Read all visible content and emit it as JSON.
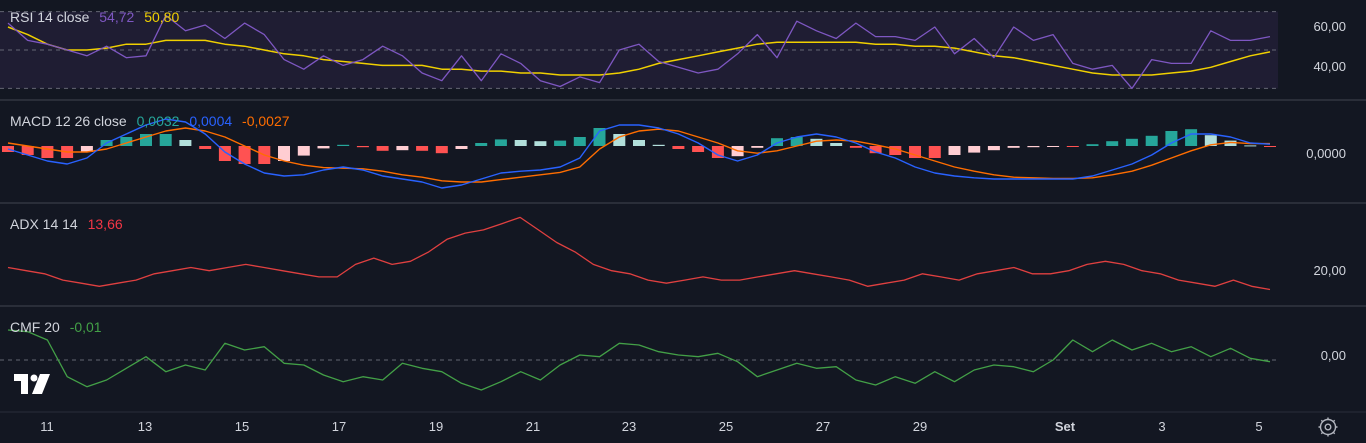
{
  "colors": {
    "background": "#131722",
    "rsi_band": "#1f1d33",
    "rsi": "#7e57c2",
    "rsi_ma": "#f0d000",
    "macd": "#2962ff",
    "signal": "#ff6d00",
    "hist_up_strong": "#26a69a",
    "hist_up_weak": "#b2dfdb",
    "hist_down_strong": "#ff5252",
    "hist_down_weak": "#ffcdd2",
    "adx": "#e04040",
    "cmf": "#43a047",
    "macd_value": "#26a69a",
    "macd_signal_value": "#2962ff",
    "macd_hist_value": "#ff6d00",
    "cmf_value": "#43a047"
  },
  "legends": {
    "rsi": {
      "label": "RSI 14 close",
      "value": "54,72",
      "ma": "50,80"
    },
    "macd": {
      "label": "MACD 12 26 close",
      "macd": "0,0032",
      "signal": "0,0004",
      "hist": "-0,0027"
    },
    "adx": {
      "label": "ADX 14 14",
      "value": "13,66"
    },
    "cmf": {
      "label": "CMF 20",
      "value": "-0,01"
    }
  },
  "axis_labels": {
    "rsi_upper": "60,00",
    "rsi_lower": "40,00",
    "macd_zero": "0,0000",
    "adx": "20,00",
    "cmf_zero": "0,00"
  },
  "x_ticks": [
    "11",
    "13",
    "15",
    "17",
    "19",
    "21",
    "23",
    "25",
    "27",
    "29",
    "Set",
    "3",
    "5"
  ],
  "chart_data": [
    {
      "type": "line",
      "name": "RSI",
      "ylim": [
        25,
        75
      ],
      "bands": [
        30,
        50,
        70
      ],
      "x": [
        0,
        1,
        2,
        3,
        4,
        5,
        6,
        7,
        8,
        9,
        10,
        11,
        12,
        13,
        14,
        15,
        16,
        17,
        18,
        19,
        20,
        21,
        22,
        23,
        24,
        25,
        26,
        27,
        28,
        29,
        30,
        31,
        32,
        33,
        34,
        35,
        36,
        37,
        38,
        39,
        40,
        41,
        42,
        43,
        44,
        45,
        46,
        47,
        48,
        49,
        50,
        51,
        52,
        53,
        54,
        55,
        56,
        57,
        58,
        59,
        60,
        61,
        62,
        63,
        64
      ],
      "rsi": [
        64,
        55,
        53,
        50,
        47,
        52,
        46,
        47,
        68,
        60,
        63,
        56,
        64,
        58,
        45,
        40,
        47,
        42,
        45,
        52,
        47,
        38,
        34,
        47,
        34,
        48,
        43,
        34,
        31,
        36,
        33,
        50,
        53,
        44,
        41,
        38,
        40,
        48,
        58,
        46,
        65,
        60,
        56,
        64,
        57,
        57,
        55,
        62,
        48,
        56,
        46,
        62,
        55,
        58,
        43,
        40,
        42,
        30,
        45,
        43,
        43,
        60,
        55,
        55,
        57
      ],
      "rsi_ma": [
        62,
        58,
        53,
        50,
        50,
        51,
        53,
        53,
        55,
        55,
        55,
        53,
        52,
        50,
        48,
        47,
        45,
        44,
        43,
        42,
        42,
        42,
        40,
        40,
        39,
        39,
        38,
        38,
        37,
        37,
        37,
        38,
        40,
        43,
        45,
        47,
        49,
        51,
        53,
        54,
        54,
        54,
        54,
        54,
        53,
        53,
        52,
        52,
        51,
        49,
        47,
        46,
        44,
        42,
        40,
        38,
        37,
        37,
        37,
        38,
        39,
        41,
        44,
        47,
        49
      ]
    },
    {
      "type": "line",
      "name": "MACD",
      "ylim": [
        -0.009,
        0.007
      ],
      "x": [
        0,
        1,
        2,
        3,
        4,
        5,
        6,
        7,
        8,
        9,
        10,
        11,
        12,
        13,
        14,
        15,
        16,
        17,
        18,
        19,
        20,
        21,
        22,
        23,
        24,
        25,
        26,
        27,
        28,
        29,
        30,
        31,
        32,
        33,
        34,
        35,
        36,
        37,
        38,
        39,
        40,
        41,
        42,
        43,
        44,
        45,
        46,
        47,
        48,
        49,
        50,
        51,
        52,
        53,
        54,
        55,
        56,
        57,
        58,
        59,
        60,
        61,
        62,
        63,
        64
      ],
      "macd": [
        -0.0005,
        -0.0015,
        -0.0025,
        -0.003,
        -0.002,
        0.0005,
        0.002,
        0.0035,
        0.0045,
        0.004,
        0.002,
        -0.001,
        -0.003,
        -0.0045,
        -0.005,
        -0.0048,
        -0.004,
        -0.0035,
        -0.004,
        -0.005,
        -0.0055,
        -0.006,
        -0.007,
        -0.0065,
        -0.0055,
        -0.0045,
        -0.0042,
        -0.004,
        -0.0035,
        -0.002,
        0.0025,
        0.0035,
        0.0035,
        0.003,
        0.002,
        0.0005,
        -0.0015,
        -0.0025,
        -0.0015,
        0.0005,
        0.0015,
        0.002,
        0.0015,
        0.0005,
        -0.001,
        -0.002,
        -0.0035,
        -0.0045,
        -0.005,
        -0.0053,
        -0.0055,
        -0.0055,
        -0.0055,
        -0.0055,
        -0.0055,
        -0.005,
        -0.004,
        -0.003,
        -0.0015,
        0.0005,
        0.002,
        0.002,
        0.0015,
        0.0005,
        0.0003
      ],
      "signal": [
        0.0005,
        0,
        -0.0005,
        -0.001,
        -0.001,
        -0.0005,
        0.0005,
        0.0015,
        0.0025,
        0.003,
        0.0025,
        0.0015,
        0,
        -0.0015,
        -0.0025,
        -0.0032,
        -0.0036,
        -0.0037,
        -0.0038,
        -0.0042,
        -0.0048,
        -0.0052,
        -0.0058,
        -0.006,
        -0.006,
        -0.0056,
        -0.0052,
        -0.0048,
        -0.0044,
        -0.0035,
        -0.0005,
        0.0015,
        0.0025,
        0.0028,
        0.0025,
        0.0015,
        0.0005,
        -0.0008,
        -0.0012,
        -0.0008,
        0,
        0.0008,
        0.001,
        0.0008,
        0.0002,
        -0.0005,
        -0.0015,
        -0.0025,
        -0.0035,
        -0.0042,
        -0.0048,
        -0.0052,
        -0.0053,
        -0.0054,
        -0.0054,
        -0.0053,
        -0.0048,
        -0.0042,
        -0.0032,
        -0.002,
        -0.0008,
        0.0002,
        0.0006,
        0.0004,
        0.0004
      ],
      "histogram": [
        -0.001,
        -0.0015,
        -0.002,
        -0.002,
        -0.001,
        0.001,
        0.0015,
        0.002,
        0.002,
        0.001,
        -0.0005,
        -0.0025,
        -0.003,
        -0.003,
        -0.0025,
        -0.0016,
        -0.0004,
        0.0002,
        -0.0002,
        -0.0008,
        -0.0007,
        -0.0008,
        -0.0012,
        -0.0005,
        0.0005,
        0.0011,
        0.001,
        0.0008,
        0.0009,
        0.0015,
        0.003,
        0.002,
        0.001,
        0.0002,
        -0.0005,
        -0.001,
        -0.002,
        -0.0017,
        -0.0003,
        0.0013,
        0.0015,
        0.0012,
        0.0005,
        -0.0003,
        -0.0012,
        -0.0015,
        -0.002,
        -0.002,
        -0.0015,
        -0.0011,
        -0.0007,
        -0.0003,
        -0.0002,
        -0.0001,
        -0.0001,
        0.0003,
        0.0008,
        0.0012,
        0.0017,
        0.0025,
        0.0028,
        0.0018,
        0.0009,
        0.0001,
        -0.0001
      ]
    },
    {
      "type": "line",
      "name": "ADX",
      "ylim": [
        10,
        40
      ],
      "x": [
        0,
        1,
        2,
        3,
        4,
        5,
        6,
        7,
        8,
        9,
        10,
        11,
        12,
        13,
        14,
        15,
        16,
        17,
        18,
        19,
        20,
        21,
        22,
        23,
        24,
        25,
        26,
        27,
        28,
        29,
        30,
        31,
        32,
        33,
        34,
        35,
        36,
        37,
        38,
        39,
        40,
        41,
        42,
        43,
        44,
        45,
        46,
        47,
        48,
        49,
        50,
        51,
        52,
        53,
        54,
        55,
        56,
        57,
        58,
        59,
        60,
        61,
        62,
        63,
        64
      ],
      "adx": [
        21,
        20,
        19,
        17,
        16,
        15,
        16,
        17,
        19,
        20,
        21,
        20,
        21,
        22,
        21,
        20,
        19,
        18,
        18,
        22,
        24,
        22,
        23,
        26,
        30,
        32,
        33,
        35,
        37,
        33,
        29,
        26,
        22,
        20,
        19,
        17,
        16,
        17,
        18,
        17,
        17,
        18,
        19,
        20,
        19,
        18,
        17,
        15,
        16,
        17,
        19,
        18,
        17,
        19,
        20,
        21,
        19,
        19,
        20,
        22,
        23,
        22,
        20,
        19,
        17,
        16,
        15,
        17,
        15,
        14
      ]
    },
    {
      "type": "line",
      "name": "CMF",
      "ylim": [
        -0.3,
        0.3
      ],
      "x": [
        0,
        1,
        2,
        3,
        4,
        5,
        6,
        7,
        8,
        9,
        10,
        11,
        12,
        13,
        14,
        15,
        16,
        17,
        18,
        19,
        20,
        21,
        22,
        23,
        24,
        25,
        26,
        27,
        28,
        29,
        30,
        31,
        32,
        33,
        34,
        35,
        36,
        37,
        38,
        39,
        40,
        41,
        42,
        43,
        44,
        45,
        46,
        47,
        48,
        49,
        50,
        51,
        52,
        53,
        54,
        55,
        56,
        57,
        58,
        59,
        60,
        61,
        62,
        63,
        64
      ],
      "cmf": [
        0.18,
        0.17,
        0.12,
        -0.1,
        -0.16,
        -0.12,
        -0.05,
        0.02,
        -0.07,
        -0.03,
        -0.06,
        0.1,
        0.06,
        0.08,
        -0.02,
        -0.03,
        -0.09,
        -0.13,
        -0.1,
        -0.12,
        -0.02,
        -0.05,
        -0.07,
        -0.14,
        -0.18,
        -0.13,
        -0.07,
        -0.12,
        -0.03,
        0.03,
        0.02,
        0.1,
        0.09,
        0.05,
        0.03,
        0.02,
        0.04,
        -0.01,
        -0.1,
        -0.06,
        -0.02,
        -0.05,
        -0.04,
        -0.12,
        -0.15,
        -0.1,
        -0.14,
        -0.07,
        -0.13,
        -0.06,
        -0.03,
        -0.04,
        -0.07,
        0.0,
        0.12,
        0.05,
        0.12,
        0.06,
        0.1,
        0.05,
        0.08,
        0.02,
        0.07,
        0.01,
        -0.01
      ]
    }
  ]
}
